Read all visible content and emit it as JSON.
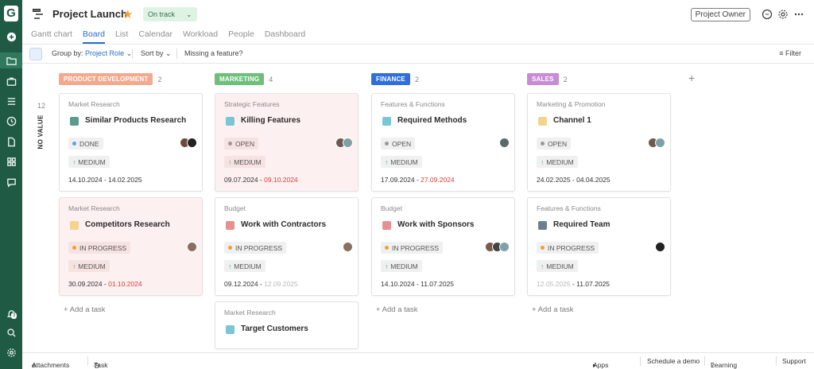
{
  "rail": {
    "logo": "G",
    "badge": "3"
  },
  "header": {
    "title": "Project Launch",
    "status": "On track",
    "owner": "Project Owner"
  },
  "tabs": [
    "Gantt chart",
    "Board",
    "List",
    "Calendar",
    "Workload",
    "People",
    "Dashboard"
  ],
  "toolbar": {
    "group_label": "Group by:",
    "group_value": "Project Role",
    "sort": "Sort by",
    "missing": "Missing a feature?",
    "filter": "Filter"
  },
  "row": {
    "label": "NO VALUE",
    "count": "12"
  },
  "columns": [
    {
      "name": "PRODUCT DEVELOPMENT",
      "count": "2",
      "color": "#f2a98e"
    },
    {
      "name": "MARKETING",
      "count": "4",
      "color": "#6fbf7c"
    },
    {
      "name": "FINANCE",
      "count": "2",
      "color": "#2f6fdc"
    },
    {
      "name": "SALES",
      "count": "2",
      "color": "#c88bd6"
    }
  ],
  "cards": [
    {
      "cat": "Market Research",
      "title": "Similar Products Research",
      "status": "DONE",
      "priority": "MEDIUM",
      "start": "14.10.2024",
      "end": "14.02.2025",
      "color": "#5c9a8c"
    },
    {
      "cat": "Market Research",
      "title": "Competitors Research",
      "status": "IN PROGRESS",
      "priority": "MEDIUM",
      "start": "30.09.2024",
      "end": "01.10.2024",
      "color": "#f5d38e"
    },
    {
      "cat": "Strategic Features",
      "title": "Killing Features",
      "status": "OPEN",
      "priority": "MEDIUM",
      "start": "09.07.2024",
      "end": "09.10.2024",
      "color": "#79c6d6"
    },
    {
      "cat": "Budget",
      "title": "Work with Contractors",
      "status": "IN PROGRESS",
      "priority": "MEDIUM",
      "start": "09.12.2024",
      "end": "12.09.2025",
      "color": "#e89090"
    },
    {
      "cat": "Market Research",
      "title": "Target Customers",
      "color": "#79c6d6"
    },
    {
      "cat": "Features & Functions",
      "title": "Required Methods",
      "status": "OPEN",
      "priority": "MEDIUM",
      "start": "17.09.2024",
      "end": "27.09.2024",
      "color": "#79c6d6"
    },
    {
      "cat": "Budget",
      "title": "Work with Sponsors",
      "status": "IN PROGRESS",
      "priority": "MEDIUM",
      "start": "14.10.2024",
      "end": "11.07.2025",
      "color": "#e89090"
    },
    {
      "cat": "Marketing & Promotion",
      "title": "Channel 1",
      "status": "OPEN",
      "priority": "MEDIUM",
      "start": "24.02.2025",
      "end": "04.04.2025",
      "color": "#f5d38e"
    },
    {
      "cat": "Features & Functions",
      "title": "Required Team",
      "status": "IN PROGRESS",
      "priority": "MEDIUM",
      "start": "12.05.2025",
      "end": "11.07.2025",
      "color": "#6f7f8f"
    }
  ],
  "add_task": "Add a task",
  "footer": {
    "attachments": "Attachments",
    "tracker": "Task time tracker",
    "apps": "Apps",
    "demo": "Schedule a demo",
    "learning": "Learning center",
    "support": "Support"
  }
}
